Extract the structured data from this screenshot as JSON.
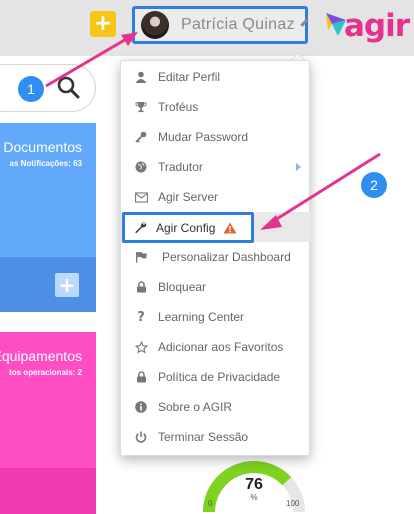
{
  "header": {
    "user_name": "Patrícia Quinaz",
    "logo_text": "agir",
    "plus_label": "+"
  },
  "callouts": {
    "badge_1": "1",
    "badge_2": "2"
  },
  "cards": {
    "documents": {
      "title": "Documentos",
      "subtitle": "as Notificações: 63",
      "add_label": "+"
    },
    "equipment": {
      "title": "Equipamentos",
      "subtitle": "tos operacionais: 2"
    }
  },
  "gauge": {
    "value": "76",
    "unit": "%",
    "min": "0",
    "max": "100"
  },
  "menu": {
    "items": [
      {
        "label": "Editar Perfil",
        "icon": "user-icon"
      },
      {
        "label": "Troféus",
        "icon": "trophy-icon"
      },
      {
        "label": "Mudar Password",
        "icon": "key-icon"
      },
      {
        "label": "Tradutor",
        "icon": "globe-icon"
      },
      {
        "label": "Agir Server",
        "icon": "envelope-icon"
      },
      {
        "label": "Agir Config",
        "icon": "wrench-icon"
      },
      {
        "label": "Personalizar Dashboard",
        "icon": "flag-icon"
      },
      {
        "label": "Bloquear",
        "icon": "lock-icon"
      },
      {
        "label": "Learning Center",
        "icon": "question-icon"
      },
      {
        "label": "Adicionar aos Favoritos",
        "icon": "star-icon"
      },
      {
        "label": "Política de Privacidade",
        "icon": "lock-icon"
      },
      {
        "label": "Sobre o AGIR",
        "icon": "info-icon"
      },
      {
        "label": "Terminar Sessão",
        "icon": "power-icon"
      }
    ]
  },
  "colors": {
    "accent_blue": "#2e7de0",
    "annotation_pink": "#e6328f",
    "warning": "#e8632a"
  }
}
